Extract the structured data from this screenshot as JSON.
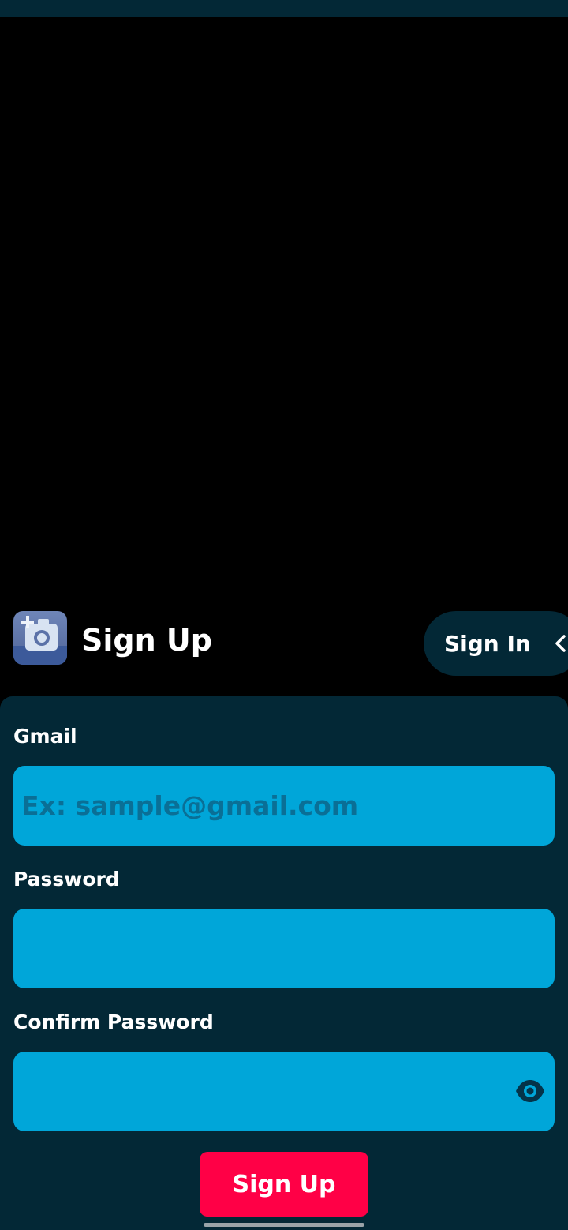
{
  "header": {
    "title": "Sign Up",
    "app_icon": "camera-plus-icon",
    "signin_label": "Sign In",
    "signin_icon": "chevron-left-icon"
  },
  "form": {
    "gmail_label": "Gmail",
    "gmail_placeholder": "Ex: sample@gmail.com",
    "gmail_value": "",
    "password_label": "Password",
    "password_value": "",
    "confirm_label": "Confirm Password",
    "confirm_value": "",
    "visibility_icon": "eye-icon",
    "submit_label": "Sign Up"
  },
  "colors": {
    "background": "#000000",
    "panel": "#032836",
    "input": "#00a6d9",
    "accent": "#ff0046"
  }
}
